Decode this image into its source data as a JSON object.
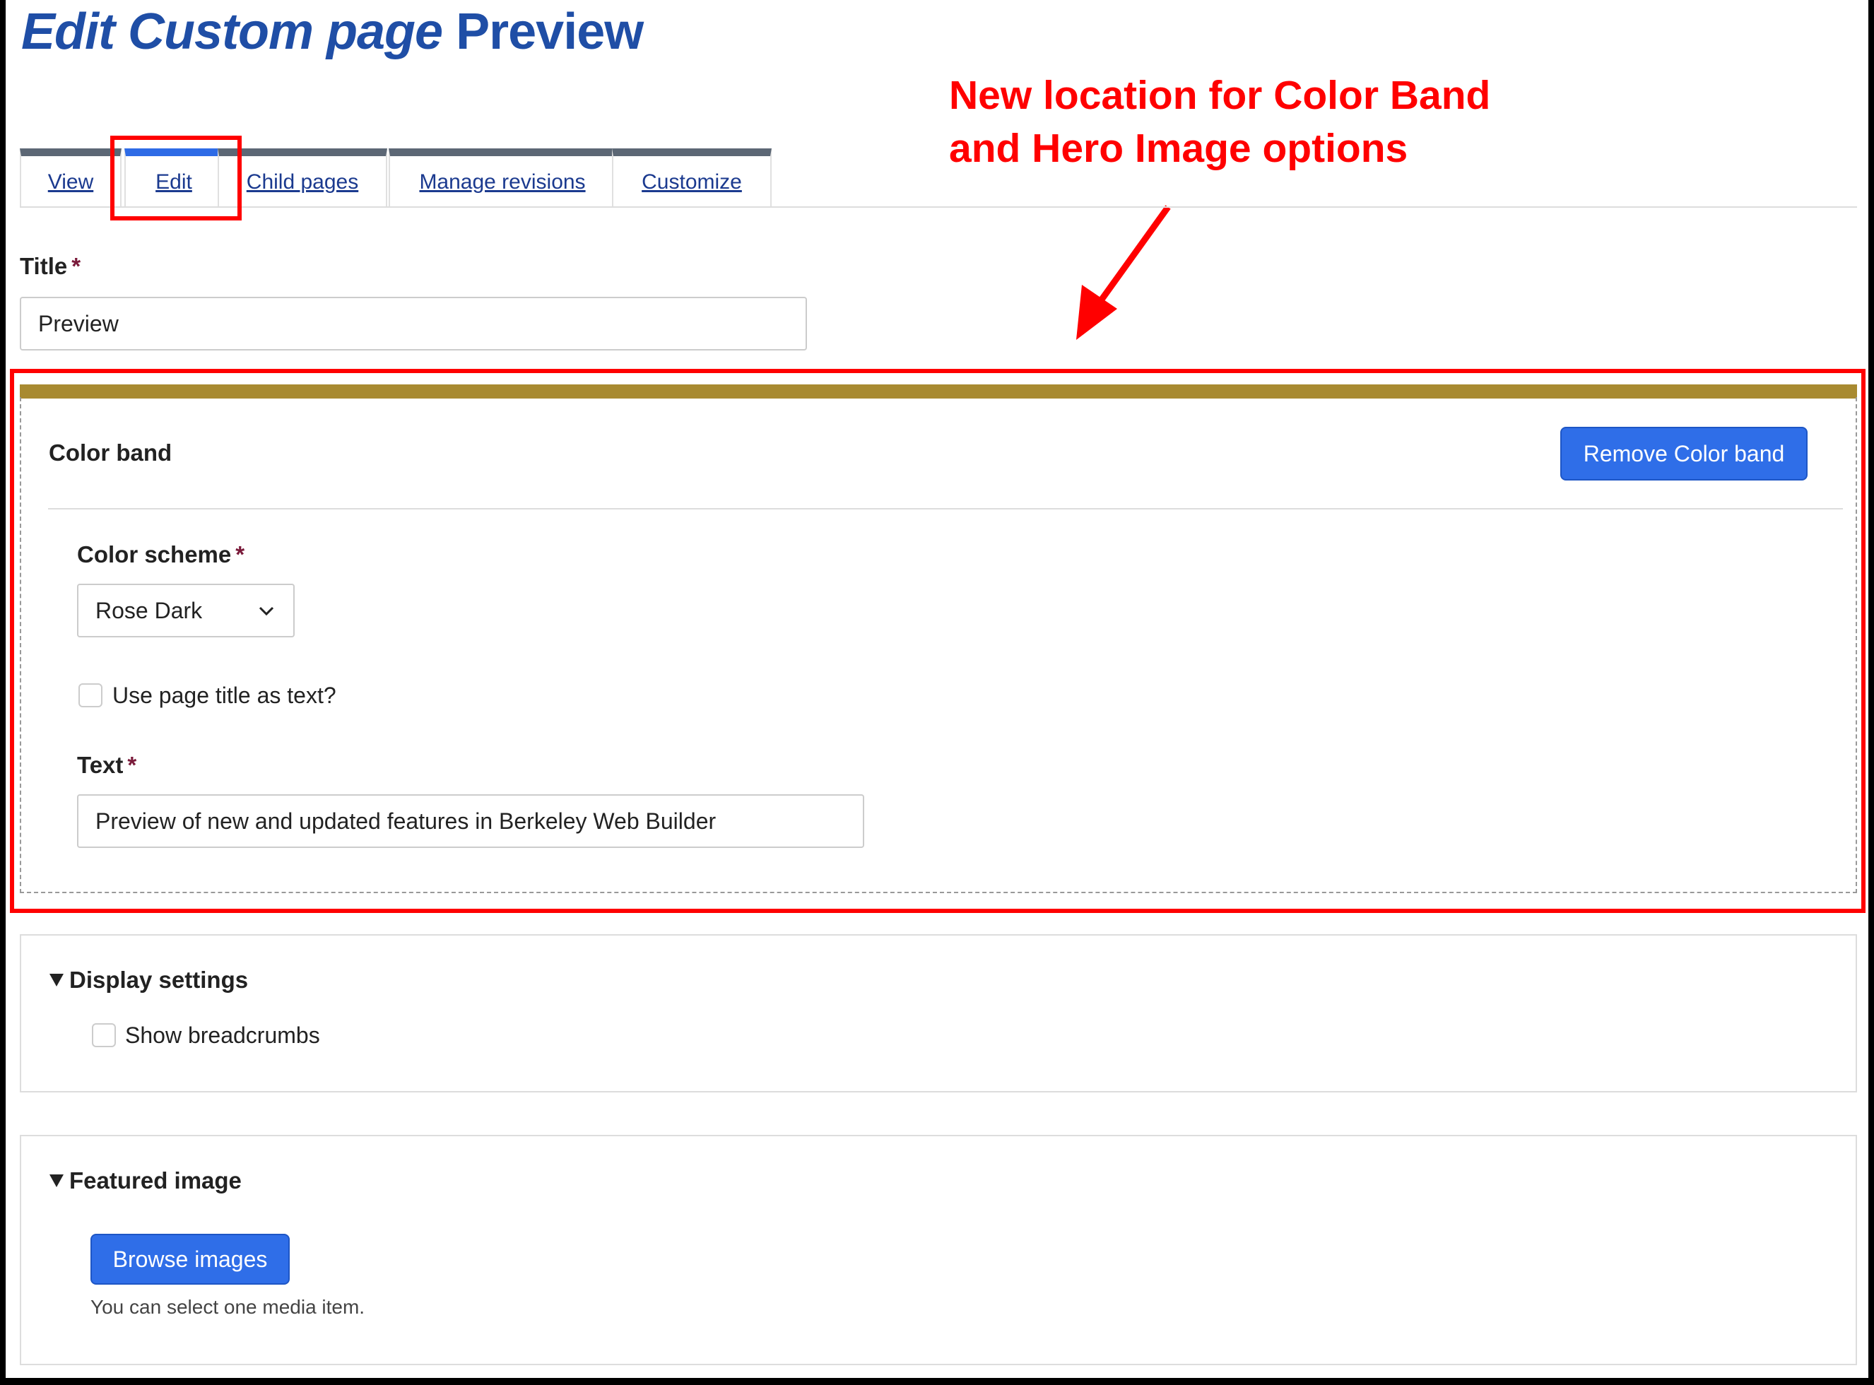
{
  "header": {
    "title_prefix": "Edit Custom page",
    "title_name": "Preview"
  },
  "annotation": {
    "line1": "New location for Color Band",
    "line2": "and Hero Image options"
  },
  "tabs": [
    {
      "label": "View",
      "active": false
    },
    {
      "label": "Edit",
      "active": true
    },
    {
      "label": "Child pages",
      "active": false
    },
    {
      "label": "Manage revisions",
      "active": false
    },
    {
      "label": "Customize",
      "active": false
    }
  ],
  "title_field": {
    "label": "Title",
    "required_mark": "*",
    "value": "Preview"
  },
  "color_band": {
    "heading": "Color band",
    "remove_label": "Remove Color band",
    "band_color": "#a88a31",
    "scheme": {
      "label": "Color scheme",
      "required_mark": "*",
      "selected": "Rose Dark"
    },
    "use_title": {
      "label": "Use page title as text?",
      "checked": false
    },
    "text": {
      "label": "Text",
      "required_mark": "*",
      "value": "Preview of new and updated features in Berkeley Web Builder"
    }
  },
  "display_settings": {
    "summary": "Display settings",
    "breadcrumbs_label": "Show breadcrumbs",
    "breadcrumbs_checked": false
  },
  "featured_image": {
    "summary": "Featured image",
    "browse_label": "Browse images",
    "help": "You can select one media item."
  },
  "colors": {
    "title_blue": "#1f4ea6",
    "annotation_red": "#ff0000",
    "button_blue": "#2f6ee8",
    "tab_active": "#2e6be6",
    "tab_inactive": "#5c6775"
  },
  "icons": {
    "chevron": "chevron-down-icon",
    "arrow": "arrow-icon",
    "disclosure": "triangle-down-icon"
  }
}
